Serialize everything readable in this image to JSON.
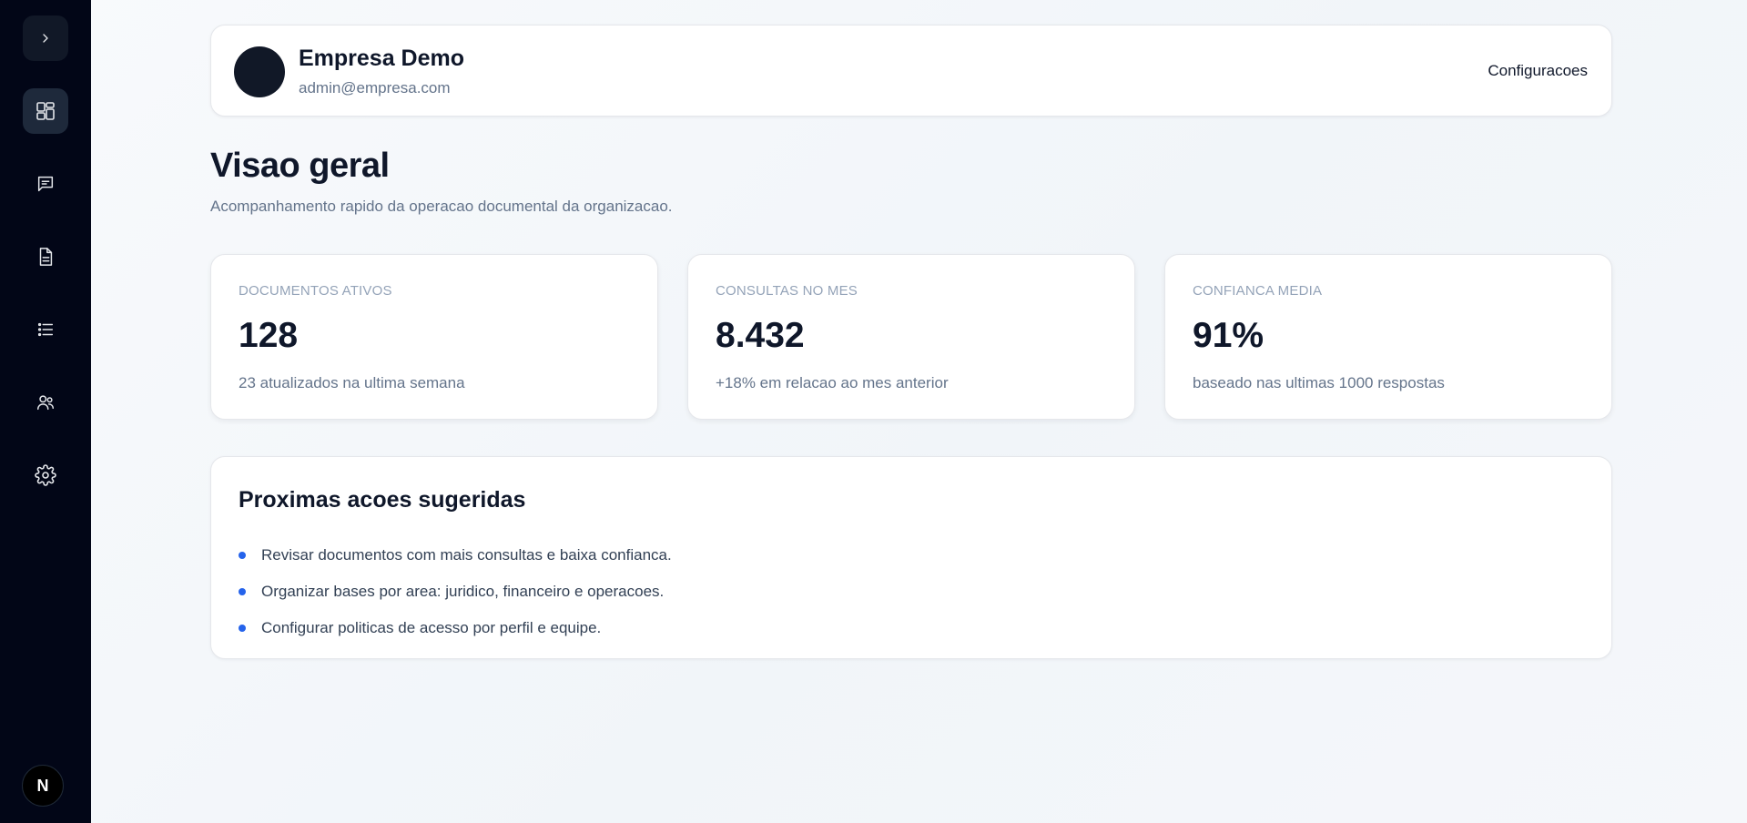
{
  "sidebar": {
    "toggle_icon": "chevron-right-icon",
    "items": [
      {
        "id": "dashboard",
        "icon": "dashboard-icon",
        "active": true
      },
      {
        "id": "chat",
        "icon": "chat-icon",
        "active": false
      },
      {
        "id": "documents",
        "icon": "document-icon",
        "active": false
      },
      {
        "id": "lists",
        "icon": "list-icon",
        "active": false
      },
      {
        "id": "users",
        "icon": "users-icon",
        "active": false
      },
      {
        "id": "settings",
        "icon": "gear-icon",
        "active": false
      }
    ],
    "bottom_badge": "N"
  },
  "header": {
    "company_name": "Empresa Demo",
    "email": "admin@empresa.com",
    "settings_label": "Configuracoes"
  },
  "page": {
    "title": "Visao geral",
    "subtitle": "Acompanhamento rapido da operacao documental da organizacao."
  },
  "stats": [
    {
      "label": "DOCUMENTOS ATIVOS",
      "value": "128",
      "desc": "23 atualizados na ultima semana"
    },
    {
      "label": "CONSULTAS NO MES",
      "value": "8.432",
      "desc": "+18% em relacao ao mes anterior"
    },
    {
      "label": "CONFIANCA MEDIA",
      "value": "91%",
      "desc": "baseado nas ultimas 1000 respostas"
    }
  ],
  "actions": {
    "title": "Proximas acoes sugeridas",
    "items": [
      "Revisar documentos com mais consultas e baixa confianca.",
      "Organizar bases por area: juridico, financeiro e operacoes.",
      "Configurar politicas de acesso por perfil e equipe."
    ]
  },
  "colors": {
    "sidebar_bg": "#020617",
    "accent": "#2563eb",
    "text_primary": "#0f172a",
    "text_muted": "#64748b"
  }
}
